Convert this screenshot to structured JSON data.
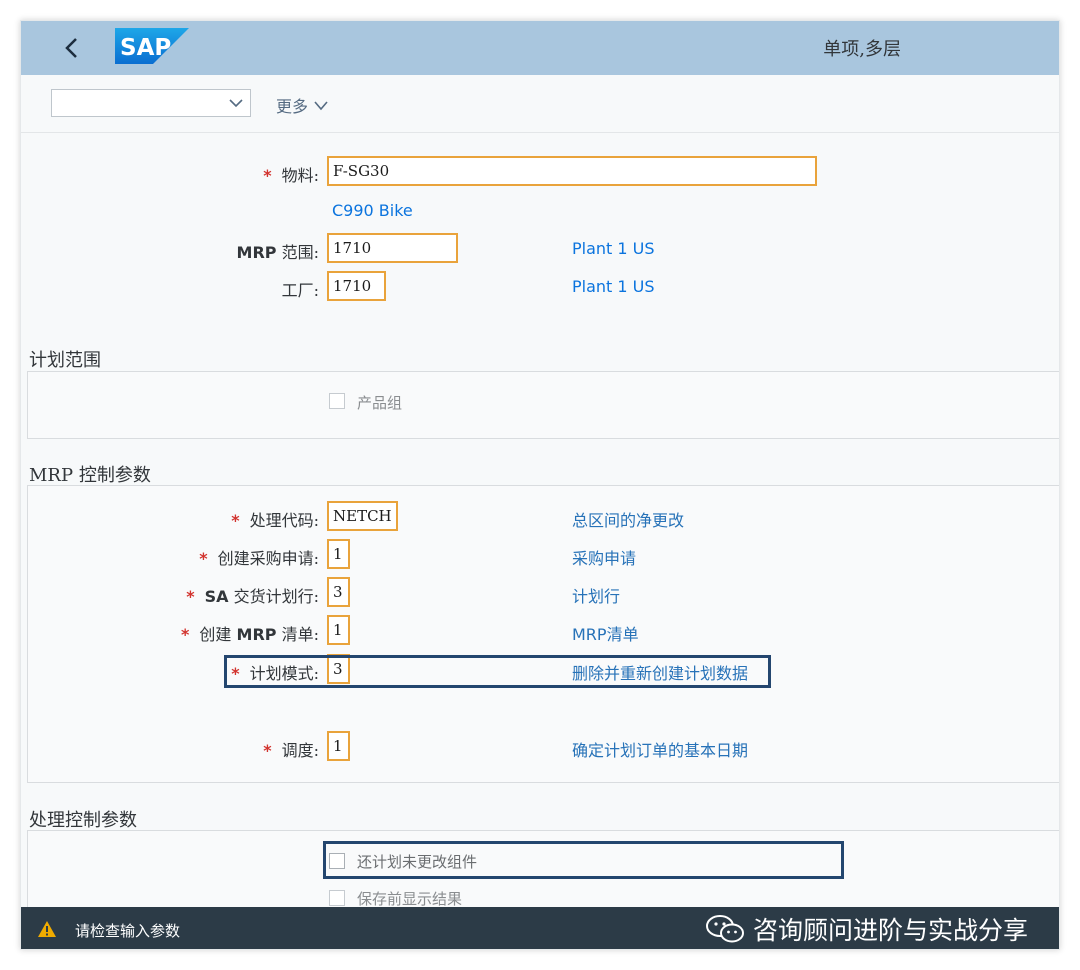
{
  "header": {
    "title": "单项,多层",
    "back_icon": "chevron-left-icon",
    "logo_text": "SAP"
  },
  "toolbar": {
    "variant_value": "",
    "more_label": "更多"
  },
  "main": {
    "material": {
      "label": "物料:",
      "value": "F-SG30",
      "description": "C990 Bike"
    },
    "mrp_area": {
      "label_prefix": "MRP",
      "label_suffix": "范围:",
      "value": "1710",
      "description": "Plant 1 US"
    },
    "plant": {
      "label": "工厂:",
      "value": "1710",
      "description": "Plant 1 US"
    }
  },
  "planning_scope": {
    "title": "计划范围",
    "product_group": {
      "label": "产品组",
      "checked": false
    }
  },
  "mrp_control": {
    "title": "MRP 控制参数",
    "processing_key": {
      "label": "处理代码:",
      "value": "NETCH",
      "description": "总区间的净更改"
    },
    "create_pur_req": {
      "label": "创建采购申请:",
      "value": "1",
      "description": "采购申请"
    },
    "sa_schedule_lines": {
      "label_prefix": "SA",
      "label_suffix": "交货计划行:",
      "value": "3",
      "description": "计划行"
    },
    "create_mrp_list": {
      "label_prefix": "创建",
      "label_mid": "MRP",
      "label_suffix": "清单:",
      "value": "1",
      "description_prefix": "MRP",
      "description_suffix": "清单"
    },
    "planning_mode": {
      "label": "计划模式:",
      "value": "3",
      "description": "删除并重新创建计划数据"
    },
    "scheduling": {
      "label": "调度:",
      "value": "1",
      "description": "确定计划订单的基本日期"
    }
  },
  "process_control": {
    "title": "处理控制参数",
    "also_plan_unchanged": {
      "label": "还计划未更改组件",
      "checked": false
    },
    "display_before_save": {
      "label": "保存前显示结果",
      "checked": false
    }
  },
  "footer": {
    "message": "请检查输入参数",
    "warning_icon": "warning-triangle-icon"
  },
  "watermark": {
    "text": "咨询顾问进阶与实战分享",
    "icon": "wechat-icon"
  },
  "colors": {
    "header_bg": "#a9c6de",
    "input_border": "#e9a33b",
    "required": "#d2342f",
    "link": "#0b74de",
    "highlight": "#24466f",
    "footer_bg": "#2c3b47"
  }
}
